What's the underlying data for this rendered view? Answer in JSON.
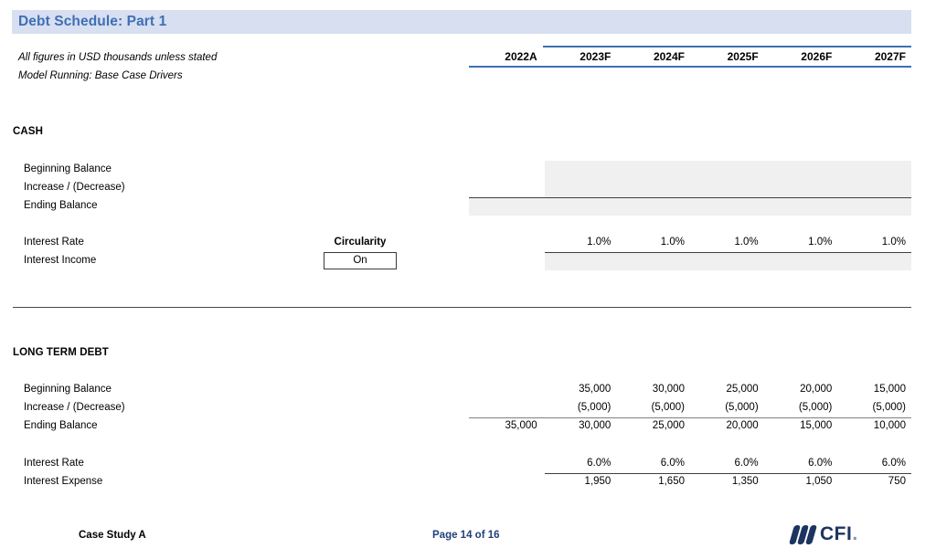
{
  "title": "Debt Schedule: Part 1",
  "notes": {
    "units": "All figures in USD thousands unless stated",
    "model": "Model Running: Base Case Drivers"
  },
  "columns": [
    "2022A",
    "2023F",
    "2024F",
    "2025F",
    "2026F",
    "2027F"
  ],
  "sections": {
    "cash": {
      "heading": "CASH",
      "rows": {
        "beginning_balance": {
          "label": "Beginning Balance",
          "values": [
            "",
            "",
            "",
            "",
            "",
            ""
          ]
        },
        "increase_decrease": {
          "label": "Increase / (Decrease)",
          "values": [
            "",
            "",
            "",
            "",
            "",
            ""
          ]
        },
        "ending_balance": {
          "label": "Ending Balance",
          "values": [
            "",
            "",
            "",
            "",
            "",
            ""
          ]
        },
        "interest_rate": {
          "label": "Interest Rate",
          "values": [
            "",
            "1.0%",
            "1.0%",
            "1.0%",
            "1.0%",
            "1.0%"
          ]
        },
        "interest_income": {
          "label": "Interest Income",
          "values": [
            "",
            "",
            "",
            "",
            "",
            ""
          ]
        }
      }
    },
    "long_term_debt": {
      "heading": "LONG TERM DEBT",
      "rows": {
        "beginning_balance": {
          "label": "Beginning Balance",
          "values": [
            "",
            "35,000",
            "30,000",
            "25,000",
            "20,000",
            "15,000"
          ]
        },
        "increase_decrease": {
          "label": "Increase / (Decrease)",
          "values": [
            "",
            "(5,000)",
            "(5,000)",
            "(5,000)",
            "(5,000)",
            "(5,000)"
          ]
        },
        "ending_balance": {
          "label": "Ending Balance",
          "values": [
            "35,000",
            "30,000",
            "25,000",
            "20,000",
            "15,000",
            "10,000"
          ]
        },
        "interest_rate": {
          "label": "Interest Rate",
          "values": [
            "",
            "6.0%",
            "6.0%",
            "6.0%",
            "6.0%",
            "6.0%"
          ]
        },
        "interest_expense": {
          "label": "Interest Expense",
          "values": [
            "",
            "1,950",
            "1,650",
            "1,350",
            "1,050",
            "750"
          ]
        }
      }
    }
  },
  "circularity": {
    "label": "Circularity",
    "value": "On"
  },
  "footer": {
    "case": "Case Study A",
    "page": "Page 14 of 16",
    "logo_text": "CFI",
    "logo_dot": "."
  },
  "colors": {
    "banner_bg": "#d7dff0",
    "banner_text": "#3f6fb5",
    "header_rule": "#3f6fb5",
    "shade": "#f0f0f0",
    "logo": "#1d3461"
  }
}
